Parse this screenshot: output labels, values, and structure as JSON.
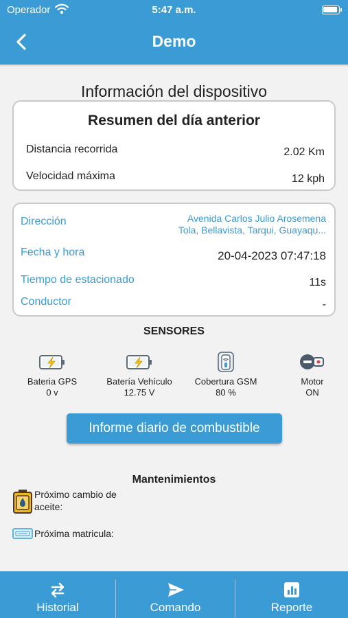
{
  "status": {
    "carrier": "Operador",
    "time": "5:47 a.m."
  },
  "nav": {
    "title": "Demo"
  },
  "section": {
    "title": "Información del dispositivo"
  },
  "summary": {
    "title": "Resumen del día anterior",
    "distance_label": "Distancia recorrida",
    "distance_value": "2.02 Km",
    "speed_label": "Velocidad máxima",
    "speed_value": "12 kph"
  },
  "details": {
    "address_label": "Dirección",
    "address_line1": "Avenida Carlos Julio Arosemena",
    "address_line2": "Tola, Bellavista, Tarqui, Guayaqu...",
    "datetime_label": "Fecha y hora",
    "datetime_value": "20-04-2023 07:47:18",
    "parked_label": "Tiempo de estacionado",
    "parked_value": "11s",
    "driver_label": "Conductor",
    "driver_value": "-"
  },
  "sensors": {
    "title": "SENSORES",
    "items": [
      {
        "label": "Bateria GPS",
        "value": "0 v",
        "icon": "battery-charging-icon"
      },
      {
        "label": "Batería Vehículo",
        "value": "12.75 V",
        "icon": "battery-charging-icon"
      },
      {
        "label": "Cobertura GSM",
        "value": "80 %",
        "icon": "gsm-signal-icon"
      },
      {
        "label": "Motor",
        "value": "ON",
        "icon": "engine-key-icon"
      }
    ]
  },
  "fuel_button": {
    "label": "Informe diario de combustible"
  },
  "maintenance": {
    "title": "Mantenimientos",
    "oil_label": "Próximo cambio de aceite:",
    "plate_label": "Próxima matricula:"
  },
  "tabs": [
    {
      "label": "Historial",
      "icon": "swap-arrows-icon"
    },
    {
      "label": "Comando",
      "icon": "send-icon"
    },
    {
      "label": "Reporte",
      "icon": "bar-chart-icon"
    }
  ],
  "colors": {
    "primary": "#3a9bd5",
    "background": "#f2f2f2",
    "battery_yellow": "#f2c21b"
  }
}
